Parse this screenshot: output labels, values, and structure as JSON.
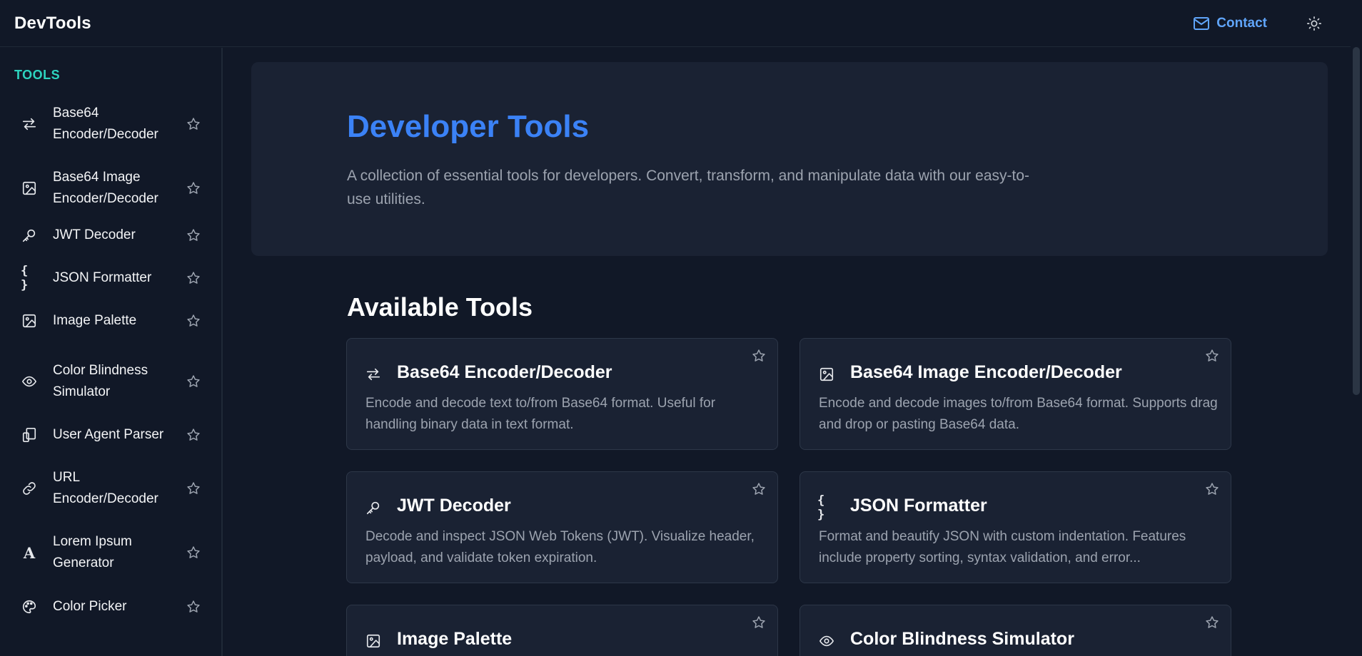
{
  "header": {
    "brand": "DevTools",
    "contact_label": "Contact",
    "contact_icon": "mail-icon",
    "theme_icon": "sun-icon"
  },
  "sidebar": {
    "heading": "TOOLS",
    "items": [
      {
        "label": "Base64 Encoder/Decoder",
        "icon": "arrows-swap-icon"
      },
      {
        "label": "Base64 Image Encoder/Decoder",
        "icon": "image-icon"
      },
      {
        "label": "JWT Decoder",
        "icon": "key-icon"
      },
      {
        "label": "JSON Formatter",
        "icon": "braces-icon"
      },
      {
        "label": "Image Palette",
        "icon": "image-icon"
      },
      {
        "label": "Color Blindness Simulator",
        "icon": "eye-icon"
      },
      {
        "label": "User Agent Parser",
        "icon": "devices-icon"
      },
      {
        "label": "URL Encoder/Decoder",
        "icon": "link-icon"
      },
      {
        "label": "Lorem Ipsum Generator",
        "icon": "font-icon"
      },
      {
        "label": "Color Picker",
        "icon": "palette-icon"
      }
    ]
  },
  "hero": {
    "title": "Developer Tools",
    "description": "A collection of essential tools for developers. Convert, transform, and manipulate data with our easy-to-use utilities."
  },
  "main": {
    "section_title": "Available Tools",
    "cards": [
      {
        "title": "Base64 Encoder/Decoder",
        "icon": "arrows-swap-icon",
        "description": "Encode and decode text to/from Base64 format. Useful for handling binary data in text format."
      },
      {
        "title": "Base64 Image Encoder/Decoder",
        "icon": "image-icon",
        "description": "Encode and decode images to/from Base64 format. Supports drag and drop or pasting Base64 data."
      },
      {
        "title": "JWT Decoder",
        "icon": "key-icon",
        "description": "Decode and inspect JSON Web Tokens (JWT). Visualize header, payload, and validate token expiration."
      },
      {
        "title": "JSON Formatter",
        "icon": "braces-icon",
        "description": "Format and beautify JSON with custom indentation. Features include property sorting, syntax validation, and error..."
      },
      {
        "title": "Image Palette",
        "icon": "image-icon",
        "description": ""
      },
      {
        "title": "Color Blindness Simulator",
        "icon": "eye-icon",
        "description": ""
      }
    ]
  },
  "colors": {
    "background": "#111827",
    "panel": "#1a2233",
    "accent_blue": "#3b82f6",
    "link_blue": "#60a5fa",
    "teal": "#2dd4bf"
  }
}
